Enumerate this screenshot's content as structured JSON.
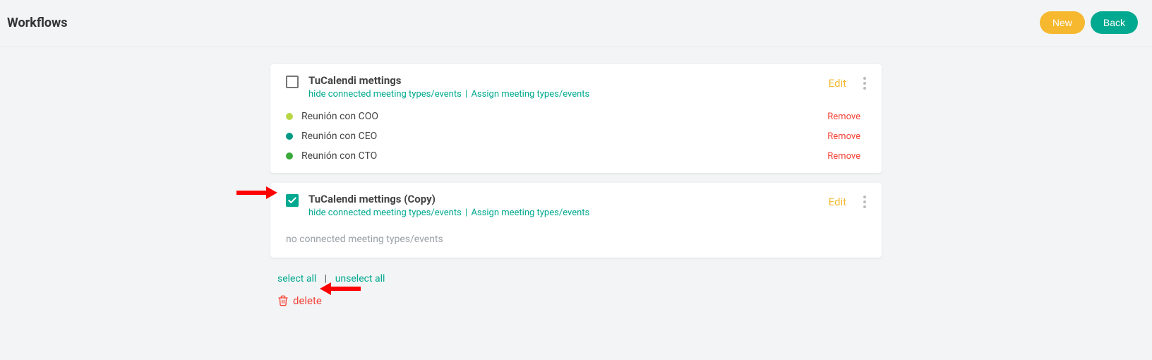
{
  "header": {
    "title": "Workflows",
    "new_label": "New",
    "back_label": "Back"
  },
  "workflows": [
    {
      "checked": false,
      "title": "TuCalendi mettings",
      "hide_link": "hide connected meeting types/events",
      "assign_link": "Assign meeting types/events",
      "edit_label": "Edit",
      "events": [
        {
          "name": "Reunión con COO",
          "color": "#b8d645",
          "remove_label": "Remove"
        },
        {
          "name": "Reunión con CEO",
          "color": "#009a84",
          "remove_label": "Remove"
        },
        {
          "name": "Reunión con CTO",
          "color": "#3aa83a",
          "remove_label": "Remove"
        }
      ]
    },
    {
      "checked": true,
      "title": "TuCalendi mettings (Copy)",
      "hide_link": "hide connected meeting types/events",
      "assign_link": "Assign meeting types/events",
      "edit_label": "Edit",
      "empty_text": "no connected meeting types/events"
    }
  ],
  "bulk": {
    "select_all": "select all",
    "unselect_all": "unselect all",
    "delete": "delete"
  }
}
